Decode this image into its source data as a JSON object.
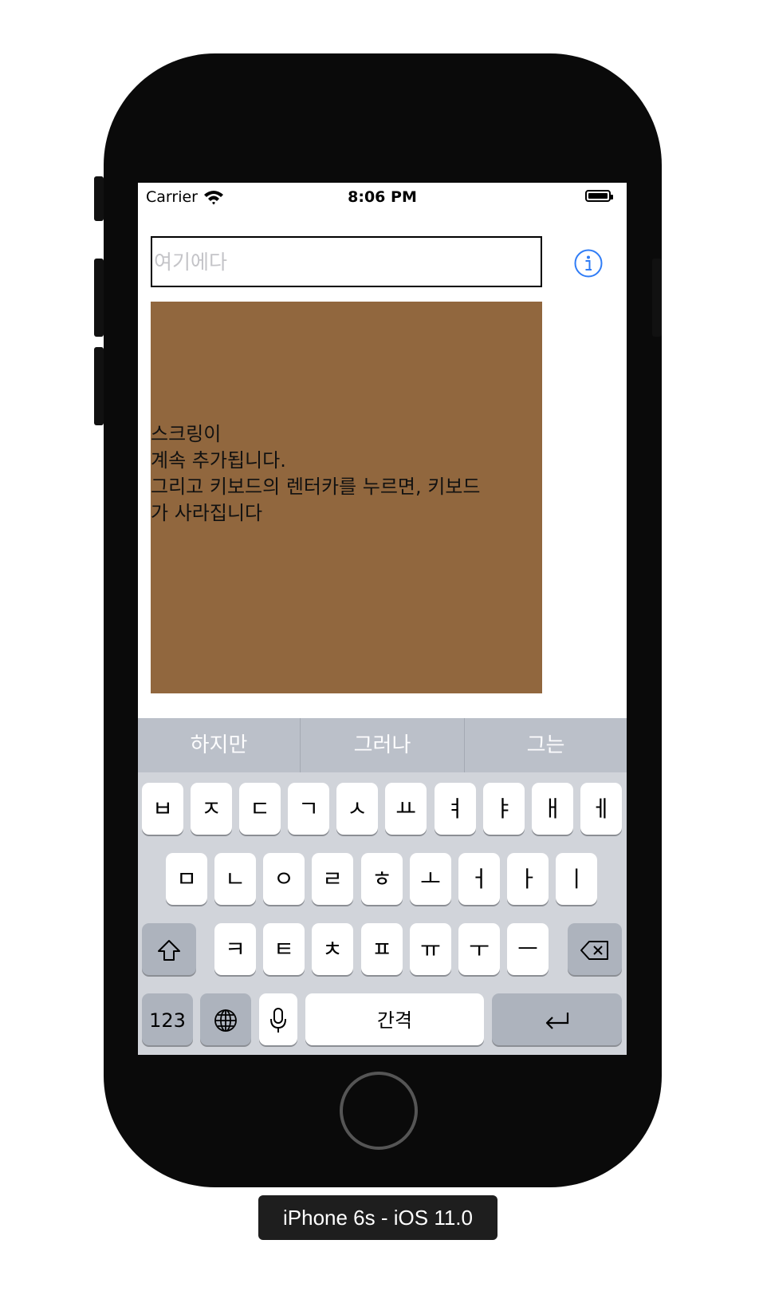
{
  "status_bar": {
    "carrier": "Carrier",
    "time": "8:06 PM"
  },
  "text_field": {
    "placeholder": "여기에다",
    "value": ""
  },
  "text_view": {
    "lines": [
      "스크링이",
      "계속 추가됩니다.",
      "그리고 키보드의 렌터카를 누르면, 키보드",
      "가 사라집니다"
    ],
    "background": "#91673e"
  },
  "predictive": [
    "하지만",
    "그러나",
    "그는"
  ],
  "keyboard": {
    "row1": [
      "ㅂ",
      "ㅈ",
      "ㄷ",
      "ㄱ",
      "ㅅ",
      "ㅛ",
      "ㅕ",
      "ㅑ",
      "ㅐ",
      "ㅔ"
    ],
    "row2": [
      "ㅁ",
      "ㄴ",
      "ㅇ",
      "ㄹ",
      "ㅎ",
      "ㅗ",
      "ㅓ",
      "ㅏ",
      "ㅣ"
    ],
    "row3": [
      "ㅋ",
      "ㅌ",
      "ㅊ",
      "ㅍ",
      "ㅠ",
      "ㅜ",
      "ㅡ"
    ],
    "numbers_label": "123",
    "space_label": "간격"
  },
  "device_label": "iPhone 6s - iOS 11.0",
  "colors": {
    "accent": "#2f7cf6",
    "keyboard_bg": "#d1d4da",
    "predictive_bg": "#bbc0c9"
  }
}
